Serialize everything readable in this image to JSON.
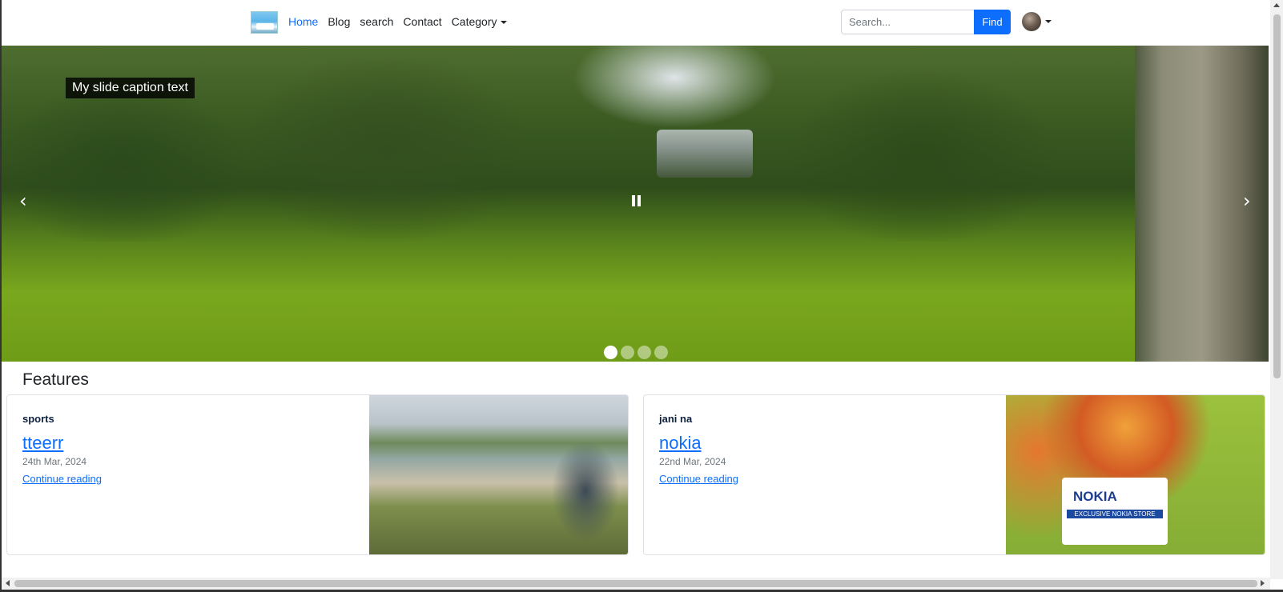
{
  "navbar": {
    "logo_icon": "site-logo",
    "links": [
      {
        "label": "Home",
        "active": true
      },
      {
        "label": "Blog",
        "active": false
      },
      {
        "label": "search",
        "active": false
      },
      {
        "label": "Contact",
        "active": false
      },
      {
        "label": "Category",
        "active": false
      }
    ],
    "search": {
      "placeholder": "Search...",
      "value": "",
      "button_label": "Find"
    },
    "avatar_icon": "user-avatar",
    "accent_color": "#0d6efd"
  },
  "carousel": {
    "caption": "My slide caption text",
    "prev_glyph": "‹",
    "next_glyph": "›",
    "slide_count": 4,
    "active_slide": 1
  },
  "features": {
    "title": "Features",
    "cards": [
      {
        "category": "sports",
        "title": "tteerr",
        "date": "24th Mar, 2024",
        "read_more": "Continue reading"
      },
      {
        "category": "jani na",
        "title": "nokia",
        "date": "22nd Mar, 2024",
        "read_more": "Continue reading",
        "image_text": {
          "brand": "NOKIA",
          "band": "EXCLUSIVE NOKIA STORE"
        }
      }
    ]
  }
}
